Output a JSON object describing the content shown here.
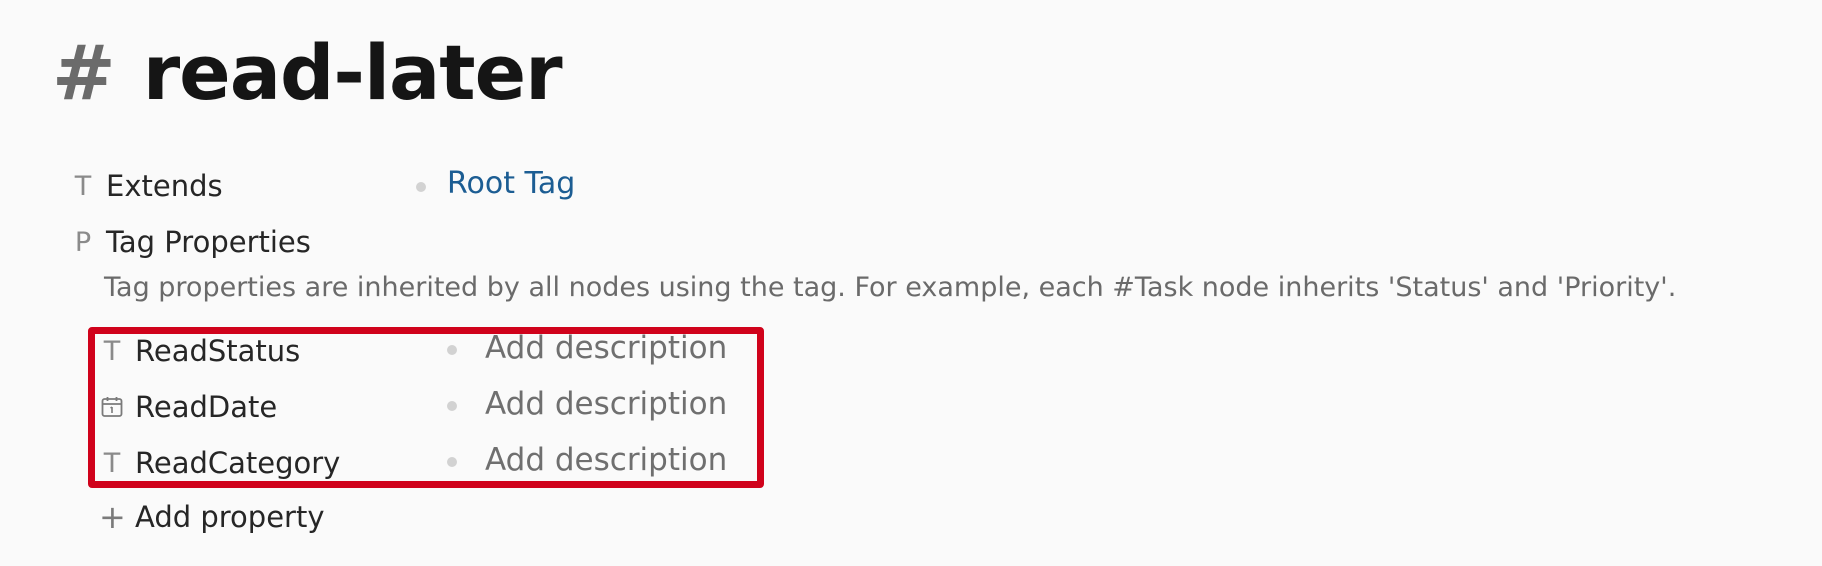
{
  "header": {
    "hash_symbol": "#",
    "title": "read-later"
  },
  "fields": {
    "extends": {
      "type_glyph": "T",
      "label": "Extends",
      "value": "Root Tag"
    },
    "tag_properties": {
      "type_glyph": "P",
      "label": "Tag Properties",
      "description": "Tag properties are inherited by all nodes using the tag. For example, each #Task node inherits 'Status' and 'Priority'."
    }
  },
  "properties": [
    {
      "icon": "text-type-icon",
      "type_glyph": "T",
      "name": "ReadStatus",
      "description_placeholder": "Add description"
    },
    {
      "icon": "calendar-icon",
      "type_glyph": "",
      "name": "ReadDate",
      "description_placeholder": "Add description"
    },
    {
      "icon": "text-type-icon",
      "type_glyph": "T",
      "name": "ReadCategory",
      "description_placeholder": "Add description"
    }
  ],
  "add_property": {
    "icon": "plus-icon",
    "glyph": "+",
    "label": "Add property"
  },
  "colors": {
    "highlight": "#d0021b",
    "link": "#1c5d93",
    "background": "#fafafa"
  }
}
